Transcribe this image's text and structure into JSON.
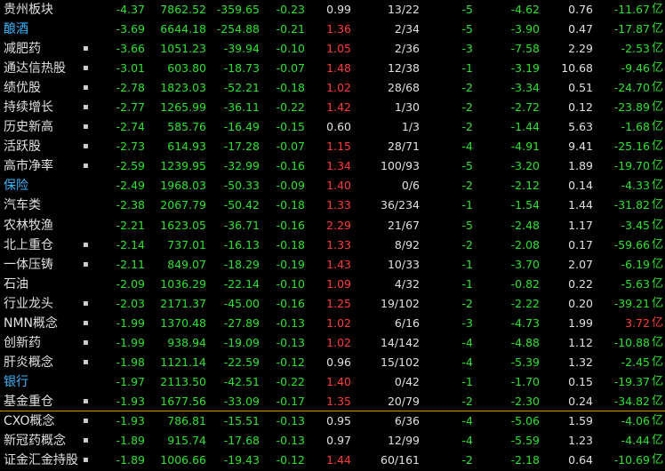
{
  "colors": {
    "up": "#ff3b3b",
    "down": "#2fe02f",
    "neutral": "#e0e0e0",
    "highlight_name": "#3fb6ff"
  },
  "unit_label": "亿",
  "rows": [
    {
      "name": "贵州板块",
      "dot": "",
      "c1": "-4.37",
      "c2": "7862.52",
      "c3": "-359.65",
      "c4": "-0.23",
      "c5": "0.99",
      "c5_up": false,
      "c6": "13/22",
      "c7": "-5",
      "c8": "-4.62",
      "c9": "0.76",
      "c10": "-11.67",
      "c10_up": false
    },
    {
      "name": "酿酒",
      "dot": "",
      "c1": "-3.69",
      "c2": "6644.18",
      "c3": "-254.88",
      "c4": "-0.21",
      "c5": "1.36",
      "c5_up": true,
      "c6": "2/34",
      "c7": "-5",
      "c8": "-3.90",
      "c9": "0.47",
      "c10": "-17.87",
      "c10_up": false
    },
    {
      "name": "减肥药",
      "dot": "▪",
      "c1": "-3.66",
      "c2": "1051.23",
      "c3": "-39.94",
      "c4": "-0.10",
      "c5": "1.05",
      "c5_up": true,
      "c6": "2/36",
      "c7": "-3",
      "c8": "-7.58",
      "c9": "2.29",
      "c10": "-2.53",
      "c10_up": false
    },
    {
      "name": "通达信热股",
      "dot": "▪",
      "c1": "-3.01",
      "c2": "603.80",
      "c3": "-18.73",
      "c4": "-0.07",
      "c5": "1.48",
      "c5_up": true,
      "c6": "12/38",
      "c7": "-1",
      "c8": "-3.19",
      "c9": "10.68",
      "c10": "-9.46",
      "c10_up": false
    },
    {
      "name": "绩优股",
      "dot": "▪",
      "c1": "-2.78",
      "c2": "1823.03",
      "c3": "-52.21",
      "c4": "-0.18",
      "c5": "1.02",
      "c5_up": true,
      "c6": "28/68",
      "c7": "-2",
      "c8": "-3.34",
      "c9": "0.51",
      "c10": "-24.70",
      "c10_up": false
    },
    {
      "name": "持续增长",
      "dot": "▪",
      "c1": "-2.77",
      "c2": "1265.99",
      "c3": "-36.11",
      "c4": "-0.22",
      "c5": "1.42",
      "c5_up": true,
      "c6": "1/30",
      "c7": "-2",
      "c8": "-2.72",
      "c9": "0.12",
      "c10": "-23.89",
      "c10_up": false
    },
    {
      "name": "历史新高",
      "dot": "▪",
      "c1": "-2.74",
      "c2": "585.76",
      "c3": "-16.49",
      "c4": "-0.15",
      "c5": "0.60",
      "c5_up": false,
      "c6": "1/3",
      "c7": "-2",
      "c8": "-1.44",
      "c9": "5.63",
      "c10": "-1.68",
      "c10_up": false
    },
    {
      "name": "活跃股",
      "dot": "▪",
      "c1": "-2.73",
      "c2": "614.93",
      "c3": "-17.28",
      "c4": "-0.07",
      "c5": "1.15",
      "c5_up": true,
      "c6": "28/71",
      "c7": "-4",
      "c8": "-4.91",
      "c9": "9.41",
      "c10": "-25.16",
      "c10_up": false
    },
    {
      "name": "高市净率",
      "dot": "▪",
      "c1": "-2.59",
      "c2": "1239.95",
      "c3": "-32.99",
      "c4": "-0.16",
      "c5": "1.34",
      "c5_up": true,
      "c6": "100/93",
      "c7": "-5",
      "c8": "-3.20",
      "c9": "1.89",
      "c10": "-19.70",
      "c10_up": false
    },
    {
      "name": "保险",
      "dot": "",
      "c1": "-2.49",
      "c2": "1968.03",
      "c3": "-50.33",
      "c4": "-0.09",
      "c5": "1.40",
      "c5_up": true,
      "c6": "0/6",
      "c7": "-2",
      "c8": "-2.12",
      "c9": "0.14",
      "c10": "-4.33",
      "c10_up": false
    },
    {
      "name": "汽车类",
      "dot": "",
      "c1": "-2.38",
      "c2": "2067.79",
      "c3": "-50.42",
      "c4": "-0.18",
      "c5": "1.33",
      "c5_up": true,
      "c6": "36/234",
      "c7": "-1",
      "c8": "-1.54",
      "c9": "1.44",
      "c10": "-31.82",
      "c10_up": false
    },
    {
      "name": "农林牧渔",
      "dot": "",
      "c1": "-2.21",
      "c2": "1623.05",
      "c3": "-36.71",
      "c4": "-0.16",
      "c5": "2.29",
      "c5_up": true,
      "c6": "21/67",
      "c7": "-5",
      "c8": "-2.48",
      "c9": "1.17",
      "c10": "-3.45",
      "c10_up": false
    },
    {
      "name": "北上重仓",
      "dot": "▪",
      "c1": "-2.14",
      "c2": "737.01",
      "c3": "-16.13",
      "c4": "-0.18",
      "c5": "1.33",
      "c5_up": true,
      "c6": "8/92",
      "c7": "-2",
      "c8": "-2.08",
      "c9": "0.17",
      "c10": "-59.66",
      "c10_up": false
    },
    {
      "name": "一体压铸",
      "dot": "▪",
      "c1": "-2.11",
      "c2": "849.07",
      "c3": "-18.29",
      "c4": "-0.19",
      "c5": "1.43",
      "c5_up": true,
      "c6": "10/33",
      "c7": "-1",
      "c8": "-3.70",
      "c9": "2.07",
      "c10": "-6.19",
      "c10_up": false
    },
    {
      "name": "石油",
      "dot": "",
      "c1": "-2.09",
      "c2": "1036.29",
      "c3": "-22.14",
      "c4": "-0.10",
      "c5": "1.09",
      "c5_up": true,
      "c6": "4/32",
      "c7": "-1",
      "c8": "-0.82",
      "c9": "0.22",
      "c10": "-5.63",
      "c10_up": false
    },
    {
      "name": "行业龙头",
      "dot": "▪",
      "c1": "-2.03",
      "c2": "2171.37",
      "c3": "-45.00",
      "c4": "-0.16",
      "c5": "1.25",
      "c5_up": true,
      "c6": "19/102",
      "c7": "-2",
      "c8": "-2.22",
      "c9": "0.20",
      "c10": "-39.21",
      "c10_up": false
    },
    {
      "name": "NMN概念",
      "dot": "▪",
      "c1": "-1.99",
      "c2": "1370.48",
      "c3": "-27.89",
      "c4": "-0.13",
      "c5": "1.02",
      "c5_up": true,
      "c6": "6/16",
      "c7": "-3",
      "c8": "-4.73",
      "c9": "1.99",
      "c10": "3.72",
      "c10_up": true
    },
    {
      "name": "创新药",
      "dot": "▪",
      "c1": "-1.99",
      "c2": "938.94",
      "c3": "-19.09",
      "c4": "-0.13",
      "c5": "1.02",
      "c5_up": true,
      "c6": "14/142",
      "c7": "-4",
      "c8": "-4.88",
      "c9": "1.12",
      "c10": "-10.88",
      "c10_up": false
    },
    {
      "name": "肝炎概念",
      "dot": "▪",
      "c1": "-1.98",
      "c2": "1121.14",
      "c3": "-22.59",
      "c4": "-0.12",
      "c5": "0.96",
      "c5_up": false,
      "c6": "15/102",
      "c7": "-4",
      "c8": "-5.39",
      "c9": "1.32",
      "c10": "-2.45",
      "c10_up": false
    },
    {
      "name": "银行",
      "dot": "",
      "c1": "-1.97",
      "c2": "2113.50",
      "c3": "-42.51",
      "c4": "-0.22",
      "c5": "1.40",
      "c5_up": true,
      "c6": "0/42",
      "c7": "-1",
      "c8": "-1.70",
      "c9": "0.15",
      "c10": "-19.37",
      "c10_up": false
    },
    {
      "name": "基金重仓",
      "dot": "▪",
      "c1": "-1.93",
      "c2": "1677.56",
      "c3": "-33.09",
      "c4": "-0.17",
      "c5": "1.35",
      "c5_up": true,
      "c6": "20/79",
      "c7": "-2",
      "c8": "-2.30",
      "c9": "0.24",
      "c10": "-34.82",
      "c10_up": false
    },
    {
      "name": "CXO概念",
      "dot": "▪",
      "c1": "-1.93",
      "c2": "786.81",
      "c3": "-15.51",
      "c4": "-0.13",
      "c5": "0.95",
      "c5_up": false,
      "c6": "6/36",
      "c7": "-4",
      "c8": "-5.06",
      "c9": "1.59",
      "c10": "-4.06",
      "c10_up": false
    },
    {
      "name": "新冠药概念",
      "dot": "▪",
      "c1": "-1.89",
      "c2": "915.74",
      "c3": "-17.68",
      "c4": "-0.13",
      "c5": "0.97",
      "c5_up": false,
      "c6": "12/99",
      "c7": "-4",
      "c8": "-5.59",
      "c9": "1.23",
      "c10": "-4.44",
      "c10_up": false
    },
    {
      "name": "证金汇金持股",
      "dot": "▪",
      "c1": "-1.89",
      "c2": "1006.66",
      "c3": "-19.43",
      "c4": "-0.12",
      "c5": "1.44",
      "c5_up": true,
      "c6": "60/161",
      "c7": "-2",
      "c8": "-2.18",
      "c9": "0.64",
      "c10": "-10.69",
      "c10_up": false
    }
  ],
  "blue_names": [
    "酿酒",
    "保险",
    "银行"
  ],
  "selected_row_index": 20
}
